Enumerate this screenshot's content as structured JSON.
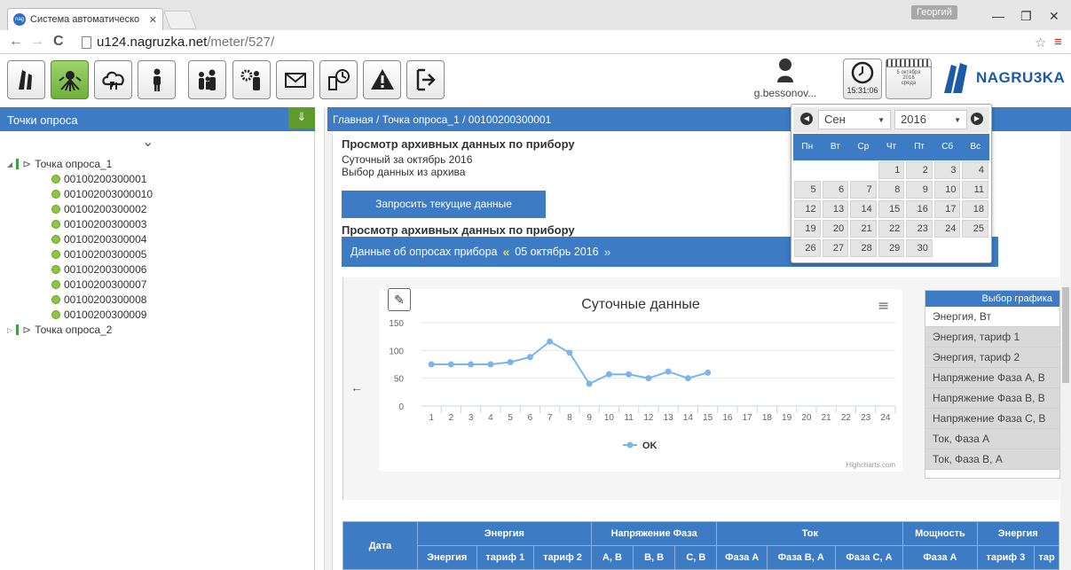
{
  "browser": {
    "tab_title": "Система автоматическо",
    "tab_favicon": "nag",
    "user_chip": "Георгий",
    "url_domain": "u124.nagruzka.net",
    "url_path": "/meter/527/"
  },
  "toolbar": {
    "icons": [
      "meter-icon",
      "network-icon",
      "cloud-icon",
      "person-icon",
      "people-icon",
      "settings-people-icon",
      "mail-icon",
      "report-icon",
      "warning-icon",
      "exit-icon"
    ],
    "active_index": 1,
    "username": "g.bessonov...",
    "clock_time": "15:31:06",
    "calendar_date": "5 октября",
    "calendar_year": "2016",
    "calendar_day": "среда",
    "logo_text": "NAGRU3KA",
    "brand_color": "#1b5aa8",
    "accent_color": "#3d7bc4"
  },
  "left": {
    "header": "Точки опроса",
    "tree": [
      {
        "label": "Точка опроса_1",
        "children": [
          "00100200300001",
          "001002003000010",
          "00100200300002",
          "00100200300003",
          "00100200300004",
          "00100200300005",
          "00100200300006",
          "00100200300007",
          "00100200300008",
          "00100200300009"
        ]
      },
      {
        "label": "Точка опроса_2",
        "children": []
      }
    ]
  },
  "main": {
    "breadcrumb": "Главная / Точка опроса_1 / 00100200300001",
    "title1": "Просмотр архивных данных по прибору",
    "sub1": "Суточный за октябрь 2016",
    "sub2": "Выбор данных из архива",
    "request_button": "Запросить текущие данные",
    "title2": "Просмотр архивных данных по прибору",
    "datebar_label": "Данные об опросах прибора",
    "datebar_prev": "«",
    "datebar_date": "05 октябрь 2016",
    "datebar_next": "»"
  },
  "chart_data": {
    "type": "line",
    "title": "Суточные данные",
    "xlabel": "",
    "ylabel": "",
    "categories": [
      1,
      2,
      3,
      4,
      5,
      6,
      7,
      8,
      9,
      10,
      11,
      12,
      13,
      14,
      15,
      16,
      17,
      18,
      19,
      20,
      21,
      22,
      23,
      24
    ],
    "series": [
      {
        "name": "OK",
        "color": "#7cb5ec",
        "values": [
          75,
          75,
          75,
          75,
          79,
          88,
          116,
          96,
          40,
          57,
          57,
          50,
          62,
          50,
          60,
          null,
          null,
          null,
          null,
          null,
          null,
          null,
          null,
          null
        ]
      }
    ],
    "y_ticks": [
      0,
      50,
      100,
      150
    ],
    "ylim": [
      0,
      150
    ],
    "grid": true,
    "legend": "bottom-center",
    "credit": "Highcharts.com"
  },
  "graph_selector": {
    "header": "Выбор графика",
    "items": [
      "Энергия, Вт",
      "Энергия, тариф 1",
      "Энергия, тариф 2",
      "Напряжение Фаза А, В",
      "Напряжение Фаза В, В",
      "Напряжение Фаза С, В",
      "Ток, Фаза А",
      "Ток, Фаза В, А"
    ],
    "selected_index": 0
  },
  "table": {
    "header_row1": [
      "Дата",
      "Энергия",
      "Напряжение Фаза",
      "Ток",
      "Мощность",
      "Энергия"
    ],
    "header_row2": [
      "Энергия",
      "тариф 1",
      "тариф 2",
      "А, В",
      "В, В",
      "С, В",
      "Фаза А",
      "Фаза В, А",
      "Фаза С, А",
      "Фаза А",
      "тариф 3",
      "тар"
    ]
  },
  "datepicker": {
    "month": "Сен",
    "year": "2016",
    "dow": [
      "Пн",
      "Вт",
      "Ср",
      "Чт",
      "Пт",
      "Сб",
      "Вс"
    ],
    "weeks": [
      [
        "",
        "",
        "",
        "1",
        "2",
        "3",
        "4"
      ],
      [
        "5",
        "6",
        "7",
        "8",
        "9",
        "10",
        "11"
      ],
      [
        "12",
        "13",
        "14",
        "15",
        "16",
        "17",
        "18"
      ],
      [
        "19",
        "20",
        "21",
        "22",
        "23",
        "24",
        "25"
      ],
      [
        "26",
        "27",
        "28",
        "29",
        "30",
        "",
        ""
      ]
    ]
  }
}
